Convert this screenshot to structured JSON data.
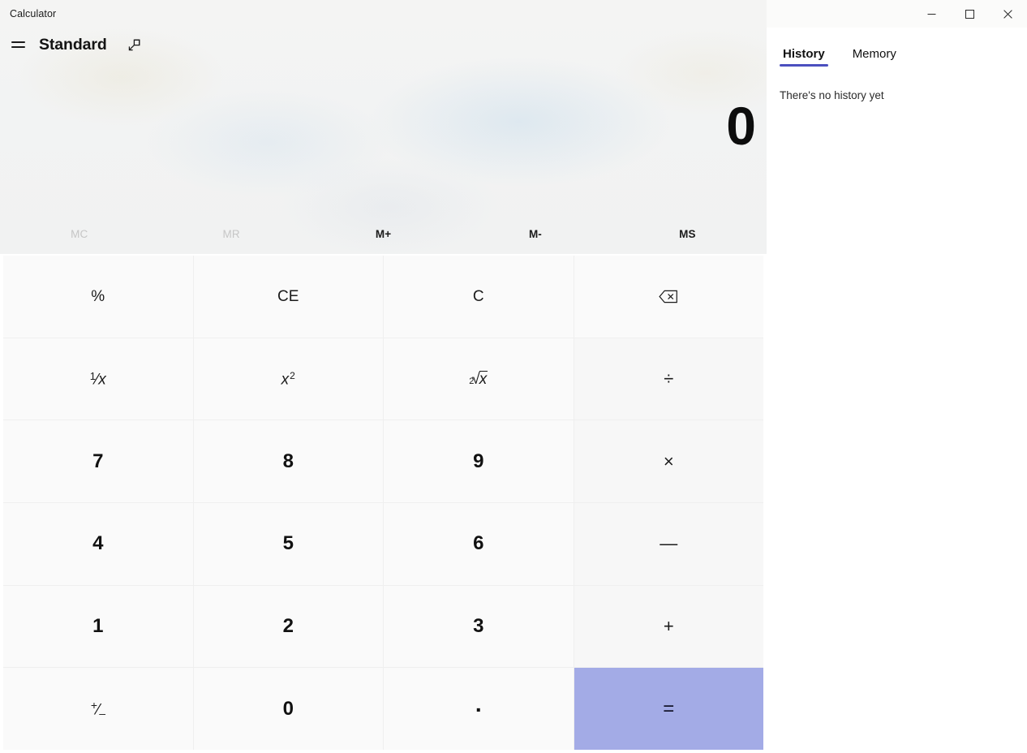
{
  "window": {
    "title": "Calculator",
    "caption_buttons": [
      {
        "name": "minimize",
        "glyph": "minimize-icon"
      },
      {
        "name": "maximize",
        "glyph": "maximize-icon"
      },
      {
        "name": "close",
        "glyph": "close-icon"
      }
    ]
  },
  "header": {
    "menu_icon": "hamburger-icon",
    "mode_title": "Standard",
    "popout_icon": "open-in-new-window-icon"
  },
  "display": {
    "value": "0"
  },
  "memory": {
    "buttons": [
      {
        "label": "MC",
        "enabled": false
      },
      {
        "label": "MR",
        "enabled": false
      },
      {
        "label": "M+",
        "enabled": true
      },
      {
        "label": "M-",
        "enabled": true
      },
      {
        "label": "MS",
        "enabled": true
      }
    ]
  },
  "keypad": {
    "rows": [
      [
        {
          "label": "%",
          "name": "percent",
          "kind": "func"
        },
        {
          "label": "CE",
          "name": "clear-entry",
          "kind": "func"
        },
        {
          "label": "C",
          "name": "clear",
          "kind": "func"
        },
        {
          "label": "",
          "name": "backspace",
          "kind": "func",
          "icon": "backspace-icon"
        }
      ],
      [
        {
          "label": "1/x",
          "name": "reciprocal",
          "kind": "func",
          "glyph": "fraction"
        },
        {
          "label": "x²",
          "name": "square",
          "kind": "func",
          "glyph": "square"
        },
        {
          "label": "2√x",
          "name": "square-root",
          "kind": "func",
          "glyph": "root"
        },
        {
          "label": "÷",
          "name": "divide",
          "kind": "op"
        }
      ],
      [
        {
          "label": "7",
          "name": "digit-7",
          "kind": "num"
        },
        {
          "label": "8",
          "name": "digit-8",
          "kind": "num"
        },
        {
          "label": "9",
          "name": "digit-9",
          "kind": "num"
        },
        {
          "label": "×",
          "name": "multiply",
          "kind": "op"
        }
      ],
      [
        {
          "label": "4",
          "name": "digit-4",
          "kind": "num"
        },
        {
          "label": "5",
          "name": "digit-5",
          "kind": "num"
        },
        {
          "label": "6",
          "name": "digit-6",
          "kind": "num"
        },
        {
          "label": "—",
          "name": "subtract",
          "kind": "op"
        }
      ],
      [
        {
          "label": "1",
          "name": "digit-1",
          "kind": "num"
        },
        {
          "label": "2",
          "name": "digit-2",
          "kind": "num"
        },
        {
          "label": "3",
          "name": "digit-3",
          "kind": "num"
        },
        {
          "label": "+",
          "name": "add",
          "kind": "op"
        }
      ],
      [
        {
          "label": "+/–",
          "name": "negate",
          "kind": "func",
          "glyph": "plusminus"
        },
        {
          "label": "0",
          "name": "digit-0",
          "kind": "num"
        },
        {
          "label": ".",
          "name": "decimal-point",
          "kind": "num-dot"
        },
        {
          "label": "=",
          "name": "equals",
          "kind": "equals"
        }
      ]
    ]
  },
  "side_panel": {
    "tabs": [
      {
        "label": "History",
        "active": true
      },
      {
        "label": "Memory",
        "active": false
      }
    ],
    "empty_message": "There's no history yet"
  },
  "colors": {
    "equals_accent": "#A3ABE6",
    "tab_underline": "#4B4FBF",
    "key_background": "#FAFAFA",
    "operator_background": "#F7F7F7",
    "grid_line": "#EFEFEF"
  }
}
